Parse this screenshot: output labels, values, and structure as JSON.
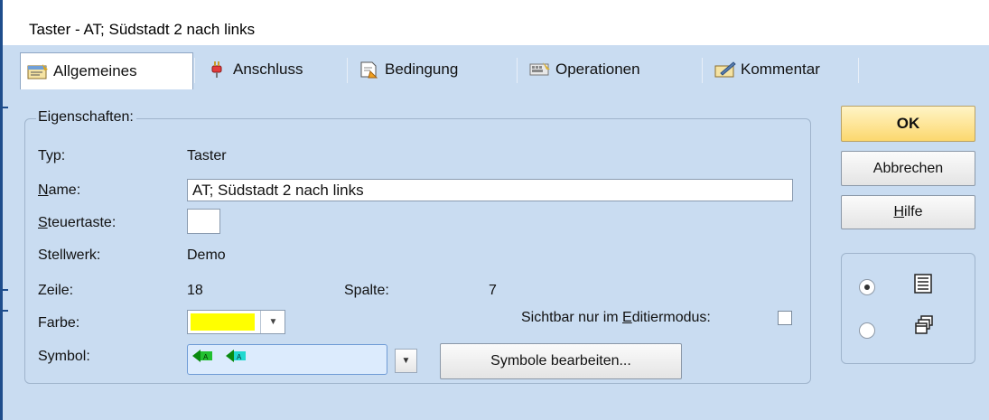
{
  "window": {
    "title": "Taster - AT; Südstadt 2 nach links"
  },
  "tabs": [
    {
      "label": "Allgemeines",
      "icon": "properties-icon",
      "active": true
    },
    {
      "label": "Anschluss",
      "icon": "plug-icon",
      "active": false
    },
    {
      "label": "Bedingung",
      "icon": "condition-icon",
      "active": false
    },
    {
      "label": "Operationen",
      "icon": "operations-icon",
      "active": false
    },
    {
      "label": "Kommentar",
      "icon": "comment-icon",
      "active": false
    }
  ],
  "properties": {
    "group_label": "Eigenschaften:",
    "type_label": "Typ:",
    "type_value": "Taster",
    "name_label_first": "N",
    "name_label_rest": "ame:",
    "name_value": "AT; Südstadt 2 nach links",
    "hotkey_label_first": "S",
    "hotkey_label_rest": "teuertaste:",
    "hotkey_value": "",
    "interlocking_label": "Stellwerk:",
    "interlocking_value": "Demo",
    "row_label": "Zeile:",
    "row_value": "18",
    "column_label": "Spalte:",
    "column_value": "7",
    "color_label": "Farbe:",
    "color_value": "#ffff00",
    "visible_label_before": "Sichtbar nur im ",
    "visible_label_first": "E",
    "visible_label_rest": "ditiermodus:",
    "visible_checked": false,
    "symbol_label": "Symbol:",
    "symbol_icons": [
      "arrow-left-green-icon",
      "arrow-left-cyan-icon"
    ]
  },
  "buttons": {
    "ok_label": "OK",
    "cancel_label": "Abbrechen",
    "help_label_first": "H",
    "help_label_rest": "ilfe",
    "edit_symbols_label": "Symbole bearbeiten..."
  },
  "view_mode": {
    "options": [
      {
        "icon": "list-view-icon",
        "selected": true
      },
      {
        "icon": "stacked-windows-icon",
        "selected": false
      }
    ]
  },
  "colors": {
    "accent": "#fcd86e",
    "background": "#c9dcf1",
    "swatch": "#ffff00"
  }
}
